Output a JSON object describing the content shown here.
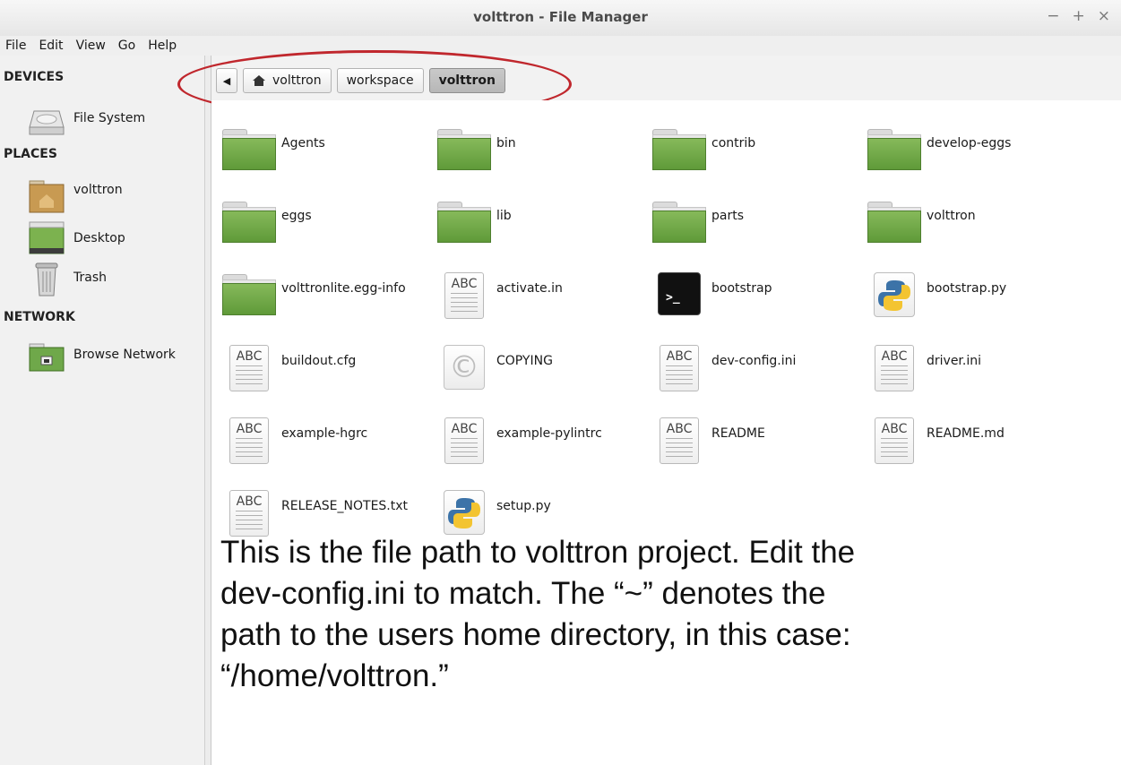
{
  "window": {
    "title": "volttron - File Manager",
    "controls": [
      "−",
      "+",
      "×"
    ]
  },
  "menu": [
    "File",
    "Edit",
    "View",
    "Go",
    "Help"
  ],
  "sidebar": {
    "devices_title": "DEVICES",
    "devices": [
      {
        "label": "File System",
        "icon": "drive-icon"
      }
    ],
    "places_title": "PLACES",
    "places": [
      {
        "label": "volttron",
        "icon": "home-folder-icon"
      },
      {
        "label": "Desktop",
        "icon": "desktop-icon"
      },
      {
        "label": "Trash",
        "icon": "trash-icon"
      }
    ],
    "network_title": "NETWORK",
    "network": [
      {
        "label": "Browse Network",
        "icon": "network-folder-icon"
      }
    ]
  },
  "pathbar": {
    "back": "◀",
    "crumbs": [
      "volttron",
      "workspace",
      "volttron"
    ],
    "active_index": 2
  },
  "files": [
    {
      "name": "Agents",
      "type": "folder"
    },
    {
      "name": "bin",
      "type": "folder"
    },
    {
      "name": "contrib",
      "type": "folder"
    },
    {
      "name": "develop-eggs",
      "type": "folder"
    },
    {
      "name": "eggs",
      "type": "folder"
    },
    {
      "name": "lib",
      "type": "folder"
    },
    {
      "name": "parts",
      "type": "folder"
    },
    {
      "name": "volttron",
      "type": "folder"
    },
    {
      "name": "volttronlite.egg-info",
      "type": "folder"
    },
    {
      "name": "activate.in",
      "type": "text"
    },
    {
      "name": "bootstrap",
      "type": "terminal"
    },
    {
      "name": "bootstrap.py",
      "type": "python"
    },
    {
      "name": "buildout.cfg",
      "type": "text"
    },
    {
      "name": "COPYING",
      "type": "copyright"
    },
    {
      "name": "dev-config.ini",
      "type": "text"
    },
    {
      "name": "driver.ini",
      "type": "text"
    },
    {
      "name": "example-hgrc",
      "type": "text"
    },
    {
      "name": "example-pylintrc",
      "type": "text"
    },
    {
      "name": "README",
      "type": "text"
    },
    {
      "name": "README.md",
      "type": "text"
    },
    {
      "name": "RELEASE_NOTES.txt",
      "type": "text"
    },
    {
      "name": "setup.py",
      "type": "python"
    }
  ],
  "icon_text": {
    "abc": "ABC",
    "term": ">_",
    "copyright": "©"
  },
  "annotation": {
    "line1": "This is the file path to volttron project.  Edit the",
    "line2": "dev-config.ini to match.  The “~” denotes the",
    "line3": "path to the users home directory, in this case:",
    "line4": "“/home/volttron.”"
  },
  "colors": {
    "folder": "#6fa84a",
    "callout": "#c0272d"
  }
}
